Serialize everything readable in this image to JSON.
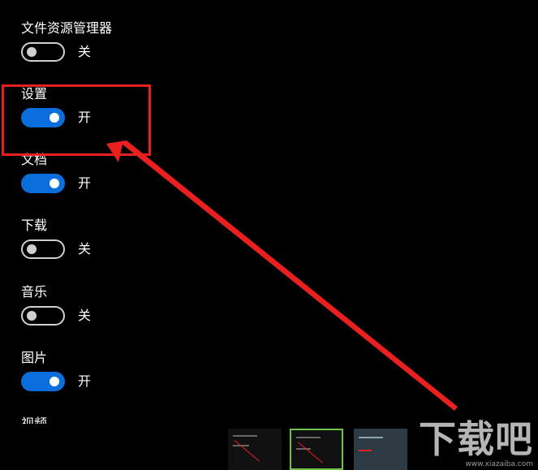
{
  "settings_list": {
    "items": [
      {
        "label": "文件资源管理器",
        "state_text": "关",
        "on": false
      },
      {
        "label": "设置",
        "state_text": "开",
        "on": true
      },
      {
        "label": "文档",
        "state_text": "开",
        "on": true
      },
      {
        "label": "下载",
        "state_text": "关",
        "on": false
      },
      {
        "label": "音乐",
        "state_text": "关",
        "on": false
      },
      {
        "label": "图片",
        "state_text": "开",
        "on": true
      },
      {
        "label": "视频"
      }
    ]
  },
  "annotation": {
    "color": "#e82020",
    "highlighted_item": "设置"
  },
  "colors": {
    "toggle_on": "#0a6fdc",
    "toggle_off_border": "#d0d0d0",
    "background": "#000000"
  },
  "thumbnails": {
    "count": 4,
    "selected_index": 1
  },
  "watermark": {
    "logo": "下载吧",
    "url": "www.xiazaiba.com"
  }
}
